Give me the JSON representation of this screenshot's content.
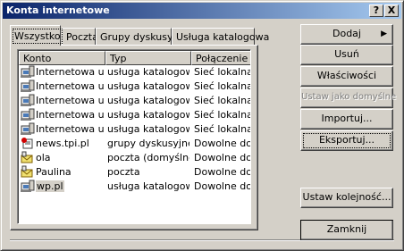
{
  "window": {
    "title": "Konta internetowe",
    "help_glyph": "?",
    "close_glyph": "X"
  },
  "tabs": [
    {
      "label": "Wszystko"
    },
    {
      "label": "Poczta"
    },
    {
      "label": "Grupy dyskusyjne"
    },
    {
      "label": "Usługa katalogowa"
    }
  ],
  "columns": [
    "Konto",
    "Typ",
    "Połączenie"
  ],
  "accounts": [
    {
      "name": "Internetowa usł...",
      "type": "usługa katalogowa",
      "connection": "Sieć lokalna",
      "icon": "directory-service-icon"
    },
    {
      "name": "Internetowa usł...",
      "type": "usługa katalogowa",
      "connection": "Sieć lokalna",
      "icon": "directory-service-icon"
    },
    {
      "name": "Internetowa usł...",
      "type": "usługa katalogowa",
      "connection": "Sieć lokalna",
      "icon": "directory-service-icon"
    },
    {
      "name": "Internetowa usł...",
      "type": "usługa katalogowa",
      "connection": "Sieć lokalna",
      "icon": "directory-service-icon"
    },
    {
      "name": "Internetowa usł...",
      "type": "usługa katalogowa",
      "connection": "Sieć lokalna",
      "icon": "directory-service-icon"
    },
    {
      "name": "news.tpi.pl",
      "type": "grupy dyskusyjne ...",
      "connection": "Dowolne dostępne",
      "icon": "newsgroup-icon"
    },
    {
      "name": "ola",
      "type": "poczta (domyślne)",
      "connection": "Dowolne dostępne",
      "icon": "mail-account-icon"
    },
    {
      "name": "Paulina",
      "type": "poczta",
      "connection": "Dowolne dostępne",
      "icon": "mail-account-icon"
    },
    {
      "name": "wp.pl",
      "type": "usługa katalogowa",
      "connection": "Dowolne dostępne",
      "icon": "directory-service-icon"
    }
  ],
  "buttons": {
    "add": "Dodaj",
    "add_arrow": "▶",
    "remove": "Usuń",
    "properties": "Właściwości",
    "set_default": "Ustaw jako domyślne",
    "import": "Importuj...",
    "export": "Eksportuj...",
    "set_order": "Ustaw kolejność...",
    "close": "Zamknij"
  },
  "colors": {
    "face": "#d4d0c8",
    "title_start": "#0a246a",
    "title_end": "#a6caf0",
    "selection_focus": "#000000"
  }
}
